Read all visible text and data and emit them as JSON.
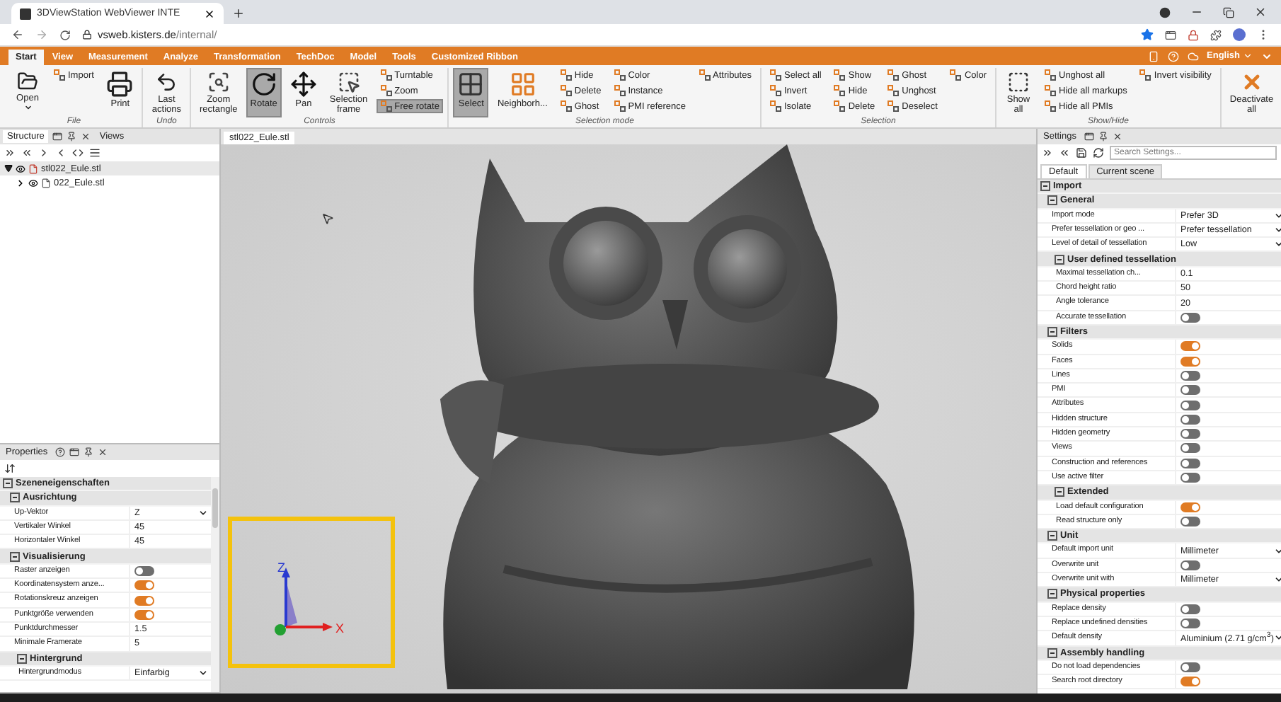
{
  "browser": {
    "tab_title": "3DViewStation WebViewer INTE",
    "url": {
      "host": "vsweb.kisters.de",
      "path": "/internal/"
    }
  },
  "ribbon": {
    "tabs": [
      {
        "label": "Start",
        "selected": true
      },
      {
        "label": "View",
        "selected": false
      },
      {
        "label": "Measurement",
        "selected": false
      },
      {
        "label": "Analyze",
        "selected": false
      },
      {
        "label": "Transformation",
        "selected": false
      },
      {
        "label": "TechDoc",
        "selected": false
      },
      {
        "label": "Model",
        "selected": false
      },
      {
        "label": "Tools",
        "selected": false
      },
      {
        "label": "Customized Ribbon",
        "selected": false
      }
    ],
    "language": "English",
    "groups": [
      {
        "label": "File",
        "columns": [
          {
            "kind": "large",
            "label": "Open",
            "selected": false,
            "dropdown": true
          },
          {
            "kind": "small",
            "items": [
              {
                "label": "Import",
                "selected": false
              }
            ]
          },
          {
            "kind": "large",
            "label": "Print",
            "selected": false
          }
        ]
      },
      {
        "label": "Undo",
        "columns": [
          {
            "kind": "large",
            "label": "Last actions",
            "selected": false
          }
        ]
      },
      {
        "label": "Controls",
        "columns": [
          {
            "kind": "large",
            "label": "Zoom rectangle",
            "selected": false
          },
          {
            "kind": "large",
            "label": "Rotate",
            "selected": true
          },
          {
            "kind": "large",
            "label": "Pan",
            "selected": false
          },
          {
            "kind": "large",
            "label": "Selection frame",
            "selected": false
          },
          {
            "kind": "small",
            "items": [
              {
                "label": "Turntable",
                "selected": false
              },
              {
                "label": "Zoom",
                "selected": false
              },
              {
                "label": "Free rotate",
                "selected": true
              }
            ]
          }
        ]
      },
      {
        "label": "Selection mode",
        "columns": [
          {
            "kind": "large",
            "label": "Select",
            "selected": true
          },
          {
            "kind": "large",
            "label": "Neighborh...",
            "selected": false
          },
          {
            "kind": "small",
            "items": [
              {
                "label": "Hide",
                "selected": false
              },
              {
                "label": "Delete",
                "selected": false
              },
              {
                "label": "Ghost",
                "selected": false
              }
            ]
          },
          {
            "kind": "small",
            "items": [
              {
                "label": "Color",
                "selected": false
              },
              {
                "label": "Instance",
                "selected": false
              },
              {
                "label": "PMI reference",
                "selected": false
              }
            ]
          },
          {
            "kind": "small",
            "items": [
              {
                "label": "Attributes",
                "selected": false
              }
            ]
          }
        ]
      },
      {
        "label": "Selection",
        "columns": [
          {
            "kind": "small",
            "items": [
              {
                "label": "Select all",
                "selected": false
              },
              {
                "label": "Invert",
                "selected": false
              },
              {
                "label": "Isolate",
                "selected": false
              }
            ]
          },
          {
            "kind": "small",
            "items": [
              {
                "label": "Show",
                "selected": false
              },
              {
                "label": "Hide",
                "selected": false
              },
              {
                "label": "Delete",
                "selected": false
              }
            ]
          },
          {
            "kind": "small",
            "items": [
              {
                "label": "Ghost",
                "selected": false
              },
              {
                "label": "Unghost",
                "selected": false
              },
              {
                "label": "Deselect",
                "selected": false
              }
            ]
          },
          {
            "kind": "small",
            "items": [
              {
                "label": "Color",
                "selected": false
              }
            ]
          }
        ]
      },
      {
        "label": "Show/Hide",
        "columns": [
          {
            "kind": "large",
            "label": "Show all",
            "selected": false
          },
          {
            "kind": "small",
            "items": [
              {
                "label": "Unghost all",
                "selected": false
              },
              {
                "label": "Hide all markups",
                "selected": false
              },
              {
                "label": "Hide all PMIs",
                "selected": false
              }
            ]
          },
          {
            "kind": "small",
            "items": [
              {
                "label": "Invert visibility",
                "selected": false
              }
            ]
          }
        ]
      },
      {
        "columns": [
          {
            "kind": "large",
            "label": "Deactivate all",
            "selected": false
          }
        ]
      }
    ]
  },
  "structure": {
    "tabs": [
      {
        "label": "Structure",
        "selected": true
      },
      {
        "label": "Views",
        "selected": false
      }
    ],
    "tree": [
      {
        "label": "stl022_Eule.stl",
        "expanded": true,
        "selected": true,
        "children": [
          {
            "label": "022_Eule.stl",
            "expanded": false,
            "selected": false
          }
        ]
      }
    ]
  },
  "viewport": {
    "tab": "stl022_Eule.stl",
    "axes": {
      "z": "Z",
      "x": "X"
    }
  },
  "properties": {
    "title": "Properties",
    "grid": [
      {
        "kind": "section",
        "title": "Szeneneigenschaften",
        "expanded": true,
        "items": [
          {
            "kind": "section",
            "title": "Ausrichtung",
            "expanded": true,
            "items": [
              {
                "kind": "select",
                "label": "Up-Vektor",
                "value": "Z"
              },
              {
                "kind": "text",
                "label": "Vertikaler Winkel",
                "value": "45"
              },
              {
                "kind": "text",
                "label": "Horizontaler Winkel",
                "value": "45"
              }
            ]
          },
          {
            "kind": "section",
            "title": "Visualisierung",
            "expanded": true,
            "items": [
              {
                "kind": "toggle",
                "label": "Raster anzeigen",
                "on": false
              },
              {
                "kind": "toggle",
                "label": "Koordinatensystem anze...",
                "on": true
              },
              {
                "kind": "toggle",
                "label": "Rotationskreuz anzeigen",
                "on": true
              },
              {
                "kind": "toggle",
                "label": "Punktgröße verwenden",
                "on": true
              },
              {
                "kind": "text",
                "label": "Punktdurchmesser",
                "value": "1.5"
              },
              {
                "kind": "text",
                "label": "Minimale Framerate",
                "value": "5"
              },
              {
                "kind": "section",
                "title": "Hintergrund",
                "expanded": true,
                "items": [
                  {
                    "kind": "select",
                    "label": "Hintergrundmodus",
                    "value": "Einfarbig"
                  }
                ]
              }
            ]
          }
        ]
      }
    ]
  },
  "settings": {
    "title": "Settings",
    "search_placeholder": "Search Settings...",
    "tabs": [
      {
        "label": "Default",
        "selected": true
      },
      {
        "label": "Current scene",
        "selected": false
      }
    ],
    "grid": [
      {
        "kind": "section",
        "title": "Import",
        "expanded": true,
        "items": [
          {
            "kind": "section",
            "title": "General",
            "expanded": true,
            "items": [
              {
                "kind": "select",
                "label": "Import mode",
                "value": "Prefer 3D"
              },
              {
                "kind": "select",
                "label": "Prefer tessellation or geo ...",
                "value": "Prefer tessellation"
              },
              {
                "kind": "select",
                "label": "Level of detail of tessellation",
                "value": "Low"
              },
              {
                "kind": "section",
                "title": "User defined tessellation",
                "expanded": true,
                "items": [
                  {
                    "kind": "text",
                    "label": "Maximal tessellation ch...",
                    "value": "0.1"
                  },
                  {
                    "kind": "text",
                    "label": "Chord height ratio",
                    "value": "50"
                  },
                  {
                    "kind": "text",
                    "label": "Angle tolerance",
                    "value": "20"
                  },
                  {
                    "kind": "toggle",
                    "label": "Accurate tessellation",
                    "on": false
                  }
                ]
              }
            ]
          },
          {
            "kind": "section",
            "title": "Filters",
            "expanded": true,
            "items": [
              {
                "kind": "toggle",
                "label": "Solids",
                "on": true
              },
              {
                "kind": "toggle",
                "label": "Faces",
                "on": true
              },
              {
                "kind": "toggle",
                "label": "Lines",
                "on": false
              },
              {
                "kind": "toggle",
                "label": "PMI",
                "on": false
              },
              {
                "kind": "toggle",
                "label": "Attributes",
                "on": false
              },
              {
                "kind": "toggle",
                "label": "Hidden structure",
                "on": false
              },
              {
                "kind": "toggle",
                "label": "Hidden geometry",
                "on": false
              },
              {
                "kind": "toggle",
                "label": "Views",
                "on": false
              },
              {
                "kind": "toggle",
                "label": "Construction and references",
                "on": false
              },
              {
                "kind": "toggle",
                "label": "Use active filter",
                "on": false
              },
              {
                "kind": "section",
                "title": "Extended",
                "expanded": true,
                "items": [
                  {
                    "kind": "toggle",
                    "label": "Load default configuration",
                    "on": true
                  },
                  {
                    "kind": "toggle",
                    "label": "Read structure only",
                    "on": false
                  }
                ]
              }
            ]
          },
          {
            "kind": "section",
            "title": "Unit",
            "expanded": true,
            "items": [
              {
                "kind": "select",
                "label": "Default import unit",
                "value": "Millimeter"
              },
              {
                "kind": "toggle",
                "label": "Overwrite unit",
                "on": false
              },
              {
                "kind": "select",
                "label": "Overwrite unit with",
                "value": "Millimeter"
              }
            ]
          },
          {
            "kind": "section",
            "title": "Physical properties",
            "expanded": true,
            "items": [
              {
                "kind": "toggle",
                "label": "Replace density",
                "on": false
              },
              {
                "kind": "toggle",
                "label": "Replace undefined densities",
                "on": false
              },
              {
                "kind": "select",
                "label": "Default density",
                "value": "Aluminium (2.71 g/cm$^{3}$)"
              }
            ]
          },
          {
            "kind": "section",
            "title": "Assembly handling",
            "expanded": true,
            "items": [
              {
                "kind": "toggle",
                "label": "Do not load dependencies",
                "on": false
              },
              {
                "kind": "toggle",
                "label": "Search root directory",
                "on": true
              }
            ]
          }
        ]
      }
    ]
  }
}
